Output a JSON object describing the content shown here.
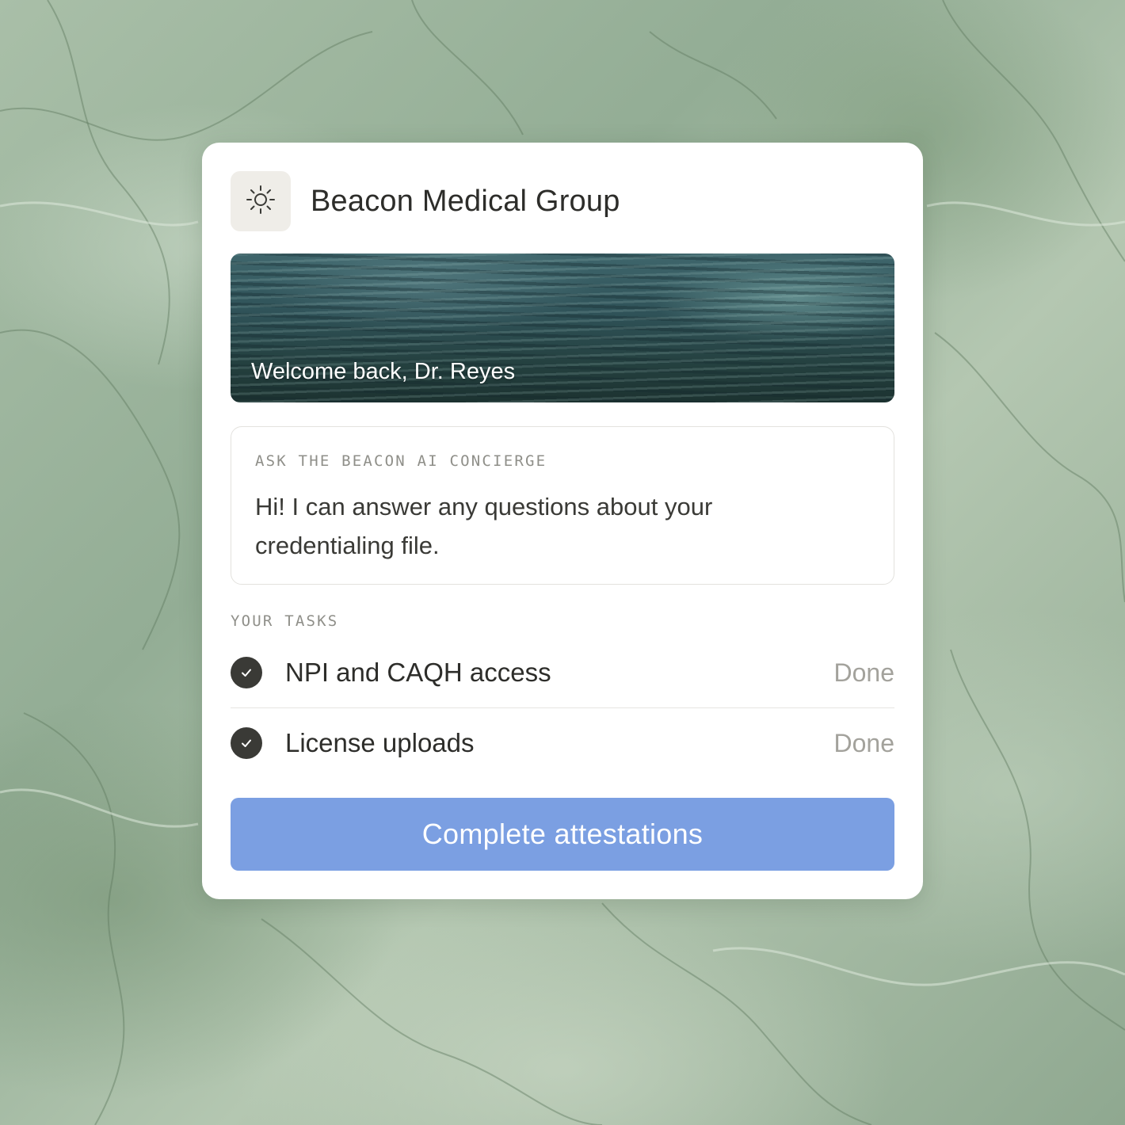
{
  "org": {
    "name": "Beacon Medical Group",
    "logo_icon": "sun-icon"
  },
  "banner": {
    "greeting": "Welcome back, Dr. Reyes"
  },
  "concierge": {
    "label": "ASK THE BEACON AI CONCIERGE",
    "message": "Hi! I can answer any questions about your credentialing file."
  },
  "tasks": {
    "label": "YOUR TASKS",
    "items": [
      {
        "name": "NPI and CAQH access",
        "status": "Done",
        "icon": "check-circle-icon"
      },
      {
        "name": "License uploads",
        "status": "Done",
        "icon": "check-circle-icon"
      }
    ]
  },
  "cta": {
    "label": "Complete attestations"
  },
  "colors": {
    "accent": "#7b9fe2",
    "check": "#3a3a36",
    "muted": "#a3a29c",
    "background": "#9fb6a0"
  }
}
